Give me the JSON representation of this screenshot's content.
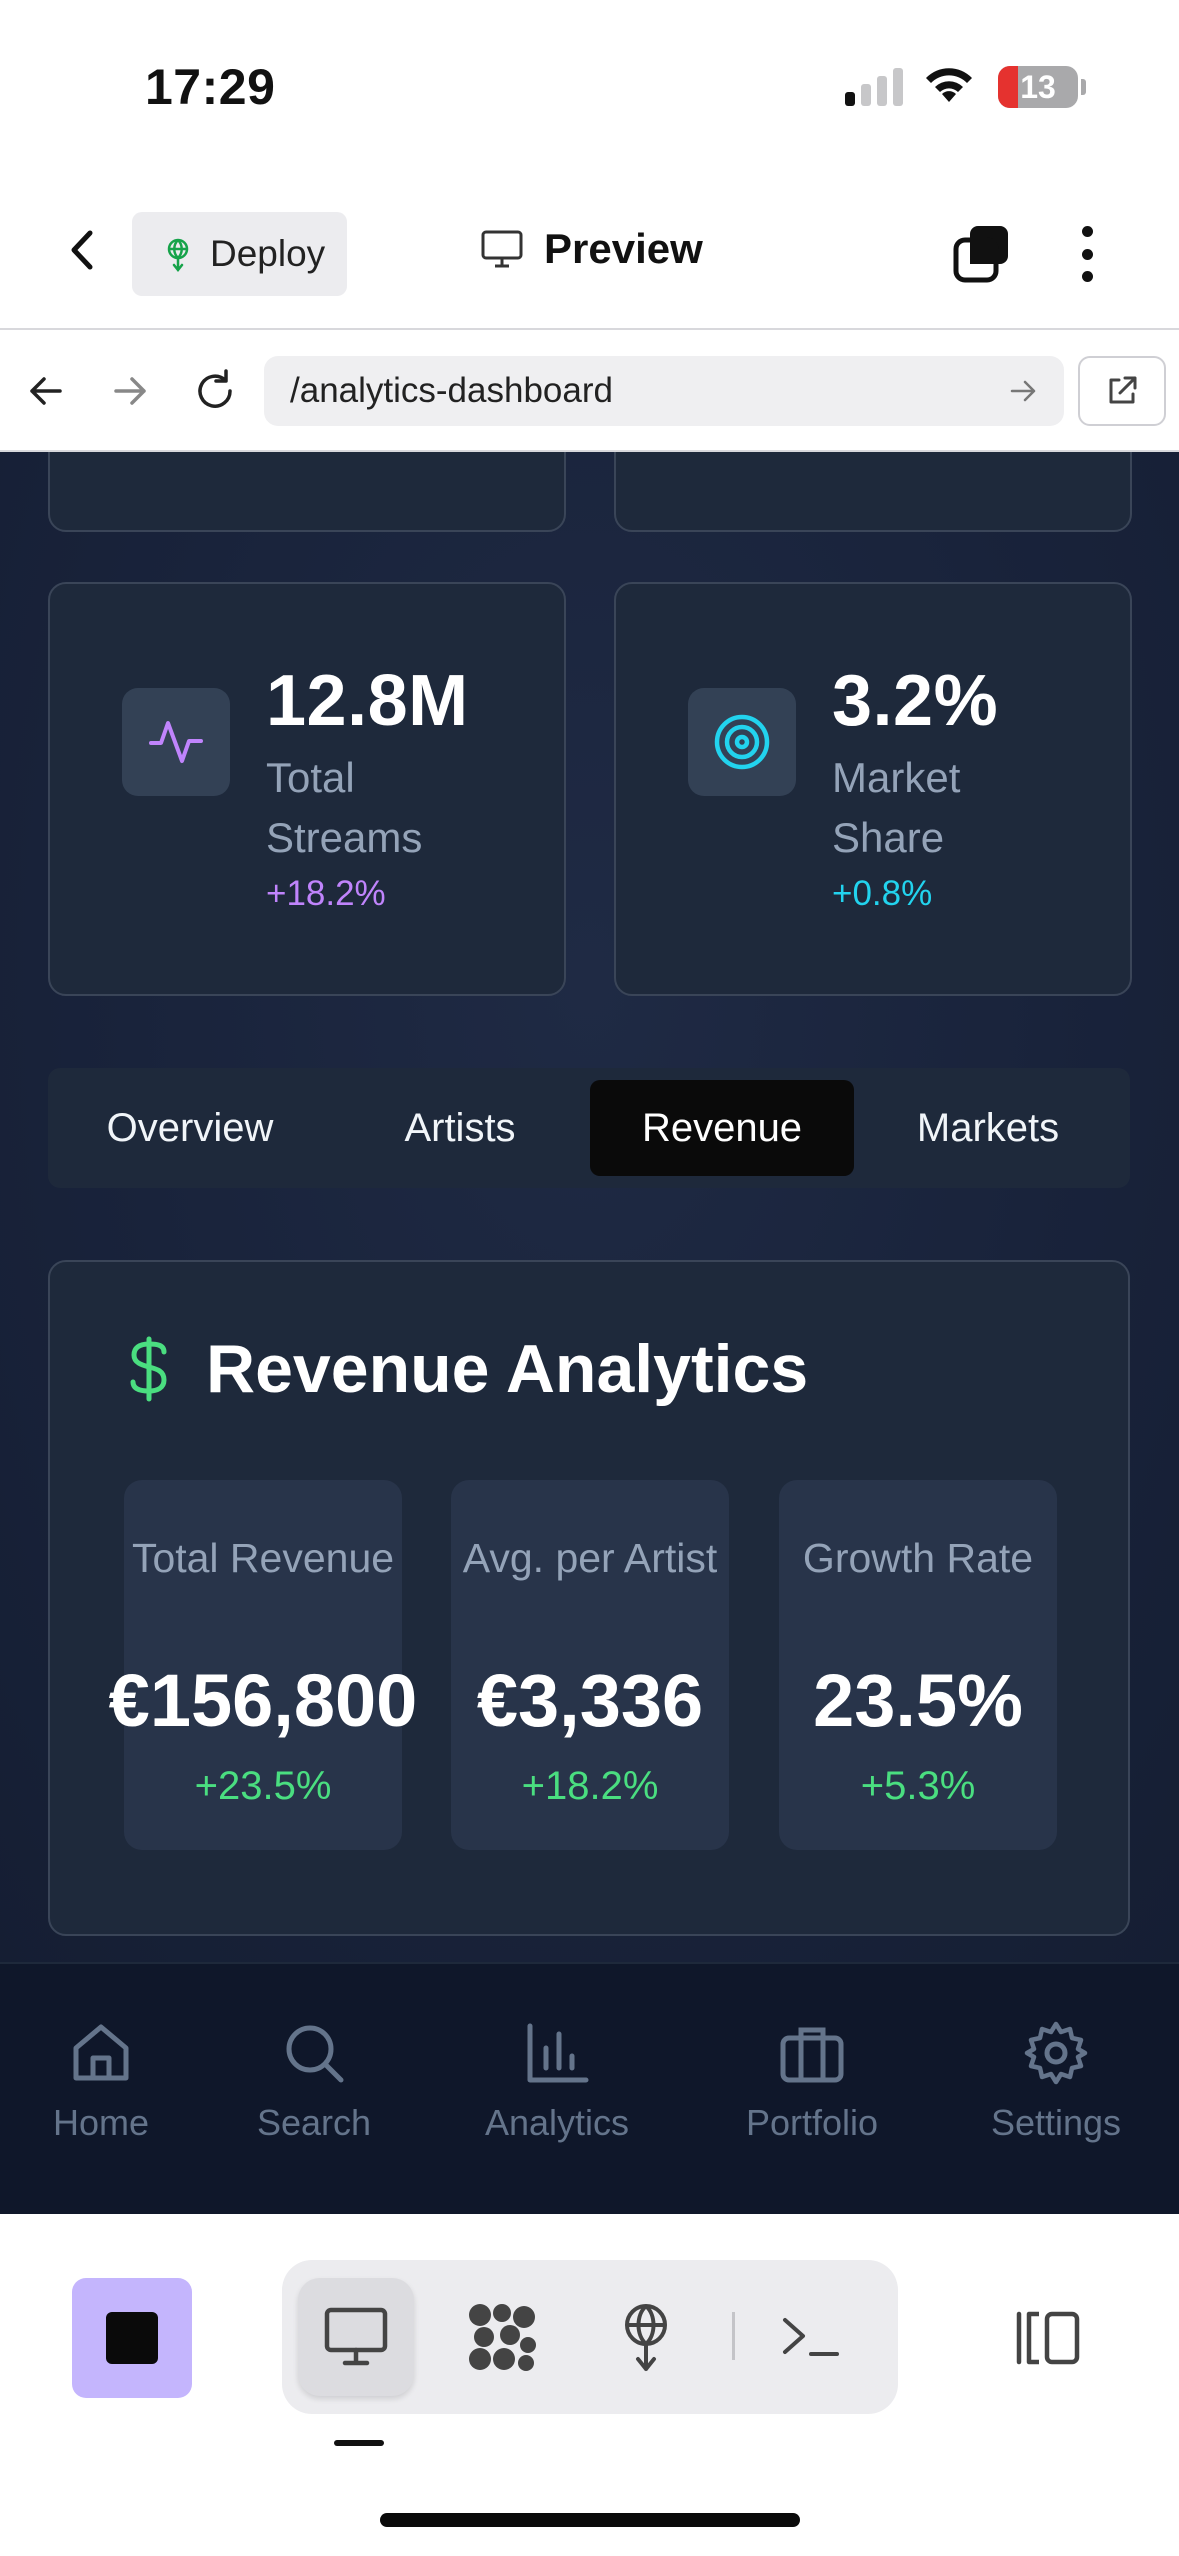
{
  "status_bar": {
    "time": "17:29",
    "battery": "13"
  },
  "header": {
    "deploy_label": "Deploy",
    "preview_label": "Preview"
  },
  "browser": {
    "url": "/analytics-dashboard"
  },
  "stats": [
    {
      "value": "12.8M",
      "label": "Total Streams",
      "change": "+18.2%",
      "icon": "activity-icon",
      "accent": "#c084fc"
    },
    {
      "value": "3.2%",
      "label": "Market Share",
      "change": "+0.8%",
      "icon": "target-icon",
      "accent": "#22d3ee"
    }
  ],
  "tabs": [
    "Overview",
    "Artists",
    "Revenue",
    "Markets"
  ],
  "active_tab": "Revenue",
  "revenue": {
    "title": "Revenue Analytics",
    "icon": "dollar-icon",
    "metrics": [
      {
        "label": "Total Revenue",
        "value": "€156,800",
        "change": "+23.5%"
      },
      {
        "label": "Avg. per Artist",
        "value": "€3,336",
        "change": "+18.2%"
      },
      {
        "label": "Growth Rate",
        "value": "23.5%",
        "change": "+5.3%"
      }
    ]
  },
  "bottom_nav": [
    "Home",
    "Search",
    "Analytics",
    "Portfolio",
    "Settings"
  ],
  "colors": {
    "positive": "#4ade80",
    "stop_button": "#c4b5fd",
    "background": "#19233b"
  }
}
